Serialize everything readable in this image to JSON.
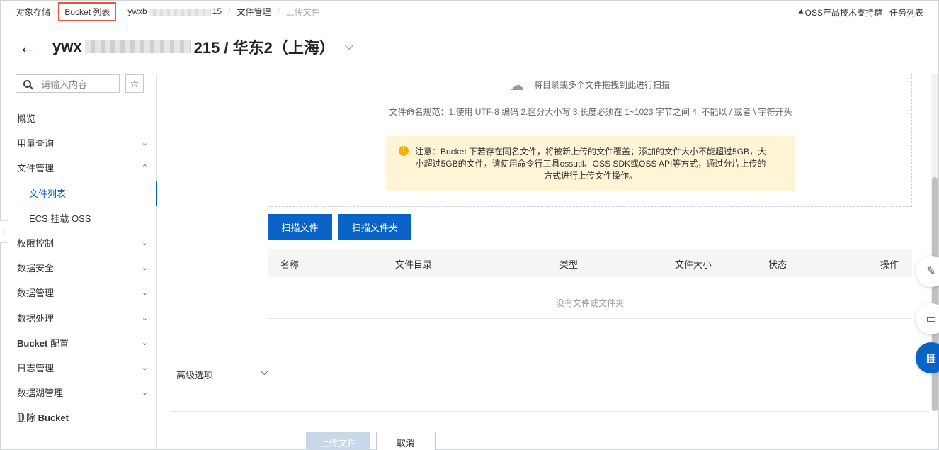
{
  "breadcrumb": {
    "root": "对象存储",
    "bucket_list": "Bucket 列表",
    "bucket_prefix": "ywxb",
    "bucket_suffix": "15",
    "file_mgmt": "文件管理",
    "current": "上传文件"
  },
  "topright": {
    "support": "OSS产品技术支持群",
    "tasks": "任务列表"
  },
  "title": {
    "back": "←",
    "prefix": "ywx",
    "suffix": "215 / 华东2（上海）",
    "chevron": "⌵"
  },
  "sidebar": {
    "search_placeholder": "请输入内容",
    "items": [
      {
        "label": "概览"
      },
      {
        "label": "用量查询",
        "arrow": "⌄"
      },
      {
        "label": "文件管理",
        "arrow": "⌃"
      },
      {
        "label": "文件列表"
      },
      {
        "label": "ECS 挂载 OSS"
      },
      {
        "label": "权限控制",
        "arrow": "⌄"
      },
      {
        "label": "数据安全",
        "arrow": "⌄"
      },
      {
        "label": "数据管理",
        "arrow": "⌄"
      },
      {
        "label": "数据处理",
        "arrow": "⌄"
      },
      {
        "label_bold": "Bucket",
        "label_rest": " 配置",
        "arrow": "⌄"
      },
      {
        "label": "日志管理",
        "arrow": "⌄"
      },
      {
        "label": "数据湖管理",
        "arrow": "⌄"
      },
      {
        "label_plain": "删除 ",
        "label_bold": "Bucket"
      }
    ]
  },
  "upload": {
    "drop_hint": "将目录或多个文件拖拽到此进行扫描",
    "naming_rule": "文件命名规范：1.使用 UTF-8 编码 2.区分大小写 3.长度必须在 1~1023 字节之间 4. 不能以 / 或者 \\ 字符开头",
    "notice": "注意：Bucket 下若存在同名文件，将被新上传的文件覆盖；添加的文件大小不能超过5GB，大小超过5GB的文件，请使用命令行工具ossutil、OSS SDK或OSS API等方式，通过分片上传的方式进行上传文件操作。",
    "scan_file": "扫描文件",
    "scan_folder": "扫描文件夹"
  },
  "table": {
    "columns": [
      "名称",
      "文件目录",
      "类型",
      "文件大小",
      "状态",
      "操作"
    ],
    "empty": "没有文件或文件夹"
  },
  "advanced": {
    "label": "高级选项"
  },
  "footer": {
    "upload": "上传文件",
    "cancel": "取消"
  },
  "colors": {
    "primary": "#0a64c8",
    "highlight_box": "#e8553c",
    "notice_bg": "#fff4d6",
    "warn_icon": "#f5b000"
  }
}
